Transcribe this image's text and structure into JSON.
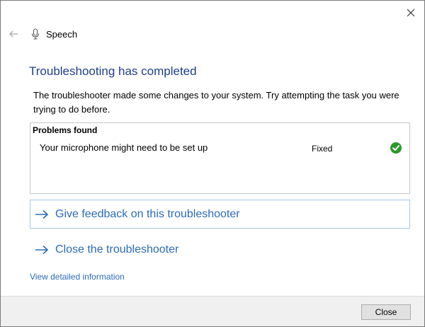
{
  "window": {
    "title": "Speech"
  },
  "header": {
    "back_icon": "back-arrow-icon",
    "app_icon": "microphone-icon",
    "close_icon": "close-icon"
  },
  "main": {
    "title": "Troubleshooting has completed",
    "description": "The troubleshooter made some changes to your system. Try attempting the task you were trying to do before.",
    "problems": {
      "heading": "Problems found",
      "items": [
        {
          "text": "Your microphone might need to be set up",
          "status": "Fixed",
          "status_icon": "checkmark-icon",
          "status_color": "#2a9a2a"
        }
      ]
    },
    "links": [
      {
        "label": "Give feedback on this troubleshooter",
        "icon": "arrow-right-icon"
      },
      {
        "label": "Close the troubleshooter",
        "icon": "arrow-right-icon"
      }
    ],
    "view_details": "View detailed information"
  },
  "footer": {
    "close_label": "Close"
  },
  "colors": {
    "title": "#1e3e8f",
    "link": "#2b6cb8",
    "footer_bg": "#f0f0f0"
  }
}
